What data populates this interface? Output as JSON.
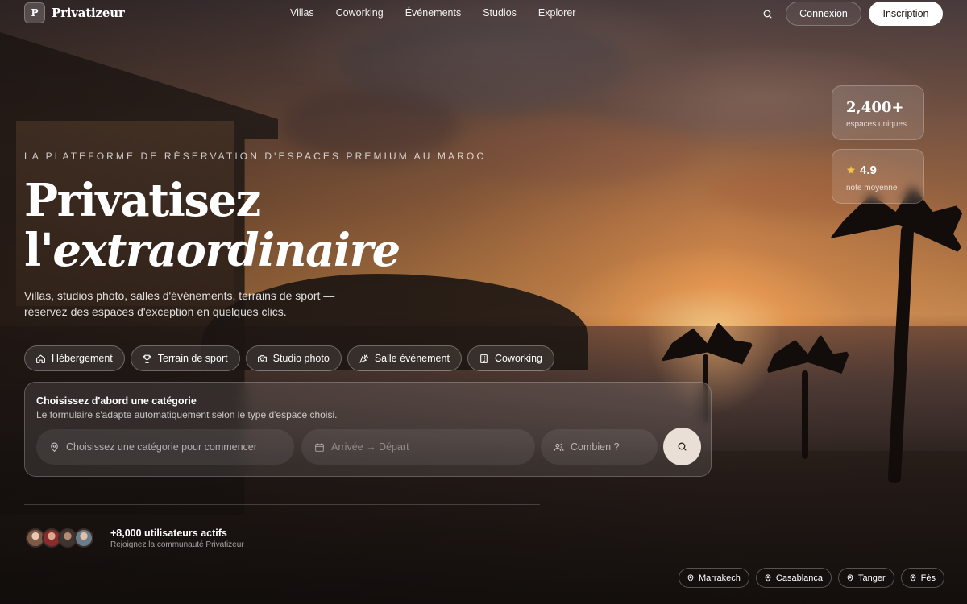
{
  "brand": {
    "mark": "P",
    "name": "Privatizeur"
  },
  "nav": [
    {
      "label": "Villas"
    },
    {
      "label": "Coworking"
    },
    {
      "label": "Événements"
    },
    {
      "label": "Studios"
    },
    {
      "label": "Explorer"
    }
  ],
  "header": {
    "login_label": "Connexion",
    "signup_label": "Inscription",
    "search_icon": "search-icon"
  },
  "stats": {
    "spaces": {
      "value": "2,400+",
      "label": "espaces uniques"
    },
    "rating": {
      "value": "4.9",
      "label": "note moyenne",
      "icon": "star-icon",
      "icon_color": "#f2c24a"
    }
  },
  "hero": {
    "eyebrow": "La plateforme de réservation d'espaces premium au Maroc",
    "title_line1": "Privatisez",
    "title_line2_prefix": "l'",
    "title_line2_em": "extraordinaire",
    "subtitle": "Villas, studios photo, salles d'événements, terrains de sport — réservez des espaces d'exception en quelques clics."
  },
  "categories": [
    {
      "label": "Hébergement",
      "icon": "home-icon"
    },
    {
      "label": "Terrain de sport",
      "icon": "trophy-icon"
    },
    {
      "label": "Studio photo",
      "icon": "camera-icon"
    },
    {
      "label": "Salle événement",
      "icon": "party-icon"
    },
    {
      "label": "Coworking",
      "icon": "building-icon"
    }
  ],
  "search_panel": {
    "title": "Choisissez d'abord une catégorie",
    "subtitle": "Le formulaire s'adapte automatiquement selon le type d'espace choisi.",
    "location_placeholder": "Choisissez une catégorie pour commencer",
    "dates_placeholder": "Arrivée → Départ",
    "guests_placeholder": "Combien ?"
  },
  "community": {
    "title": "+8,000 utilisateurs actifs",
    "subtitle": "Rejoignez la communauté Privatizeur"
  },
  "cities": [
    {
      "label": "Marrakech"
    },
    {
      "label": "Casablanca"
    },
    {
      "label": "Tanger"
    },
    {
      "label": "Fès"
    }
  ],
  "colors": {
    "accent": "#ffffff",
    "search_button": "#e9dfd6",
    "star": "#f2c24a"
  }
}
